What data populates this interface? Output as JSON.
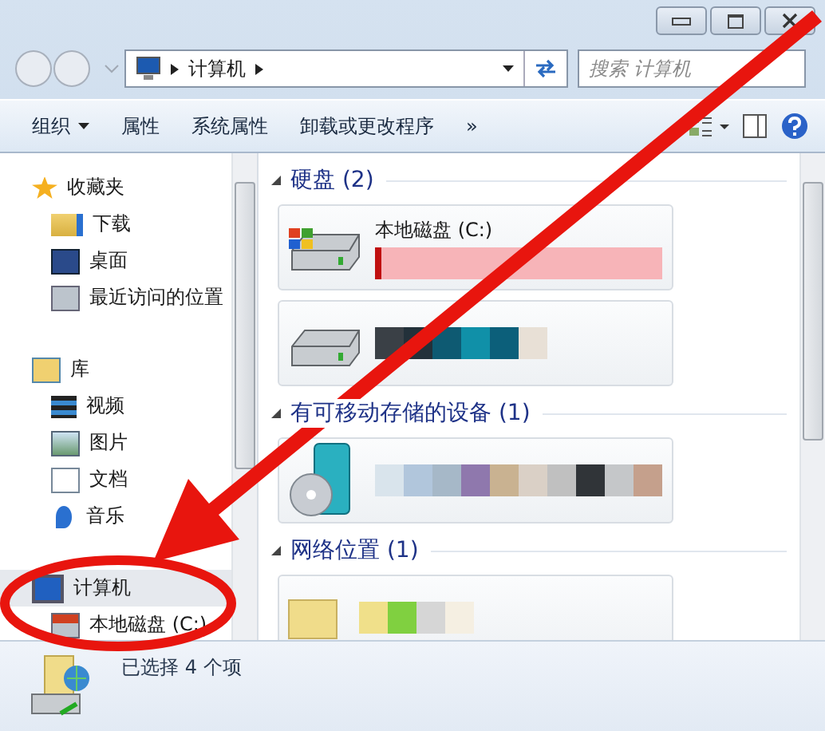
{
  "address": {
    "path": [
      "计算机"
    ]
  },
  "search": {
    "placeholder": "搜索 计算机"
  },
  "toolbar": [
    {
      "label": "组织",
      "kind": "dropdown"
    },
    {
      "label": "属性",
      "kind": "button"
    },
    {
      "label": "系统属性",
      "kind": "button"
    },
    {
      "label": "卸载或更改程序",
      "kind": "button"
    },
    {
      "label": "»",
      "kind": "button"
    }
  ],
  "sidebar": {
    "groups": [
      {
        "label": "收藏夹",
        "kind": "star",
        "selected": false,
        "children": [
          {
            "label": "下载",
            "kind": "download"
          },
          {
            "label": "桌面",
            "kind": "desktop"
          },
          {
            "label": "最近访问的位置",
            "kind": "recent"
          }
        ]
      },
      {
        "label": "库",
        "kind": "library",
        "selected": false,
        "children": [
          {
            "label": "视频",
            "kind": "video"
          },
          {
            "label": "图片",
            "kind": "picture"
          },
          {
            "label": "文档",
            "kind": "document"
          },
          {
            "label": "音乐",
            "kind": "music"
          }
        ]
      },
      {
        "label": "计算机",
        "kind": "computer",
        "selected": true,
        "children": [
          {
            "label": "本地磁盘 (C:)",
            "kind": "drive"
          }
        ]
      }
    ]
  },
  "groups": [
    {
      "title": "硬盘 (2)",
      "expanded": true,
      "tiles": [
        {
          "kind": "system-drive",
          "name": "本地磁盘 (C:)"
        },
        {
          "kind": "drive"
        }
      ]
    },
    {
      "title": "有可移动存储的设备 (1)",
      "expanded": true,
      "tiles": [
        {
          "kind": "removable"
        }
      ]
    },
    {
      "title": "网络位置 (1)",
      "expanded": true,
      "tiles": [
        {
          "kind": "network"
        }
      ]
    }
  ],
  "status_bar": {
    "text": "已选择 4 个项"
  }
}
